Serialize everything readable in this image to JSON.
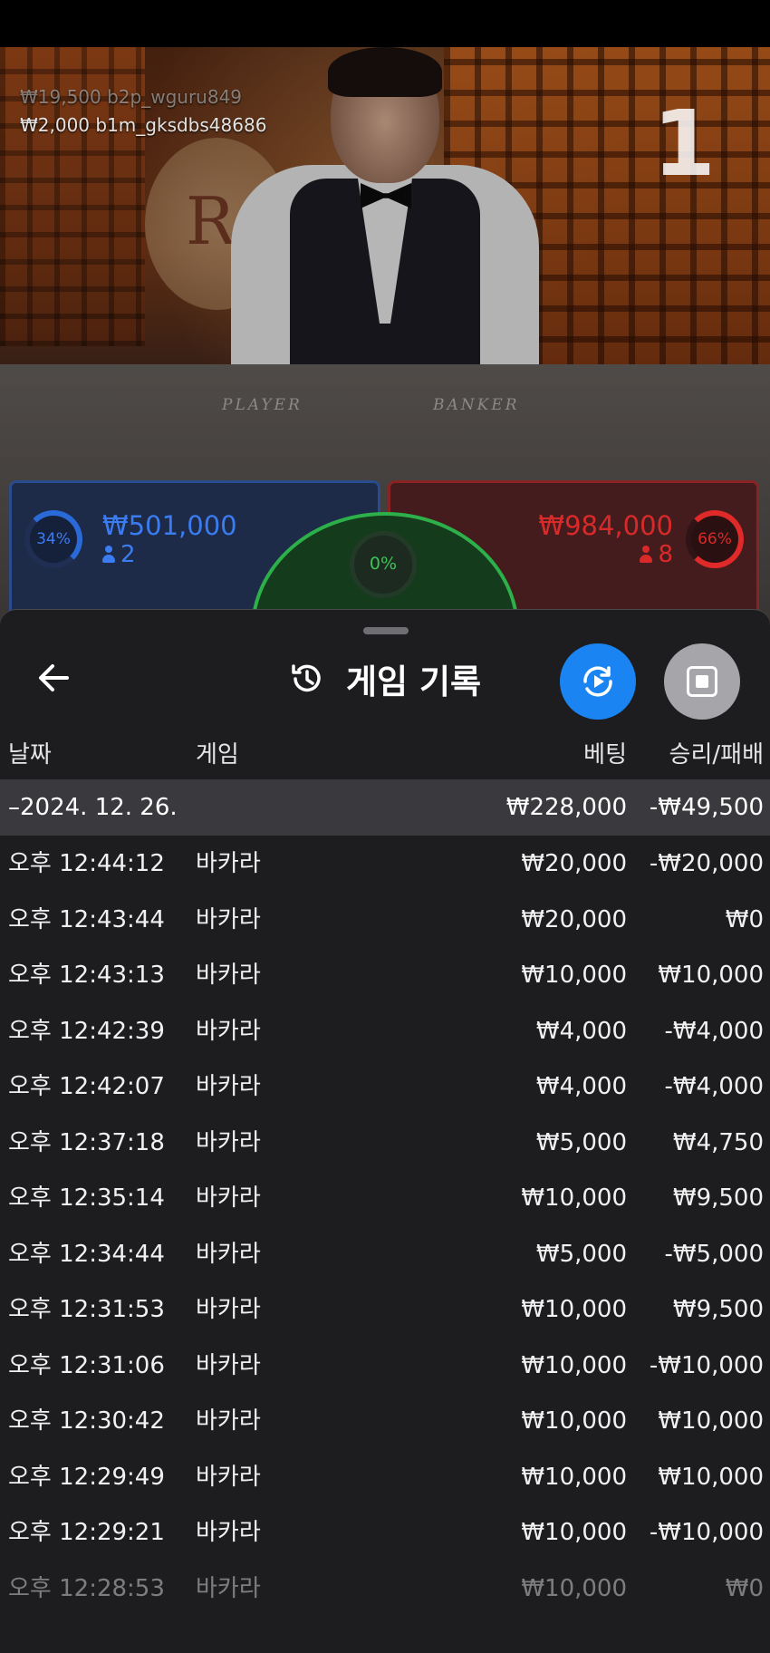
{
  "video": {
    "bet_feed": [
      "₩19,500 b2p_wguru849",
      "₩2,000  b1m_gksdbs48686"
    ],
    "round_number": "1",
    "table_labels": {
      "player": "PLAYER",
      "banker": "BANKER"
    },
    "player": {
      "percent": "34%",
      "amount": "₩501,000",
      "count": "2"
    },
    "banker": {
      "percent": "66%",
      "amount": "₩984,000",
      "count": "8"
    },
    "tie": {
      "percent": "0%"
    },
    "colors": {
      "player": "#3b7cf0",
      "banker": "#d92a2a",
      "tie": "#3cc457"
    }
  },
  "history": {
    "title": "게임 기록",
    "icons": {
      "back": "arrow-left-icon",
      "title": "history-icon",
      "replay": "replay-icon",
      "stop": "stop-icon"
    },
    "columns": {
      "date": "날짜",
      "game": "게임",
      "bet": "베팅",
      "result": "승리/패배"
    },
    "day": {
      "date": "–2024. 12. 26.",
      "bet": "₩228,000",
      "result": "-₩49,500"
    },
    "rows": [
      {
        "time": "오후 12:44:12",
        "game": "바카라",
        "bet": "₩20,000",
        "result": "-₩20,000"
      },
      {
        "time": "오후 12:43:44",
        "game": "바카라",
        "bet": "₩20,000",
        "result": "₩0"
      },
      {
        "time": "오후 12:43:13",
        "game": "바카라",
        "bet": "₩10,000",
        "result": "₩10,000"
      },
      {
        "time": "오후 12:42:39",
        "game": "바카라",
        "bet": "₩4,000",
        "result": "-₩4,000"
      },
      {
        "time": "오후 12:42:07",
        "game": "바카라",
        "bet": "₩4,000",
        "result": "-₩4,000"
      },
      {
        "time": "오후 12:37:18",
        "game": "바카라",
        "bet": "₩5,000",
        "result": "₩4,750"
      },
      {
        "time": "오후 12:35:14",
        "game": "바카라",
        "bet": "₩10,000",
        "result": "₩9,500"
      },
      {
        "time": "오후 12:34:44",
        "game": "바카라",
        "bet": "₩5,000",
        "result": "-₩5,000"
      },
      {
        "time": "오후 12:31:53",
        "game": "바카라",
        "bet": "₩10,000",
        "result": "₩9,500"
      },
      {
        "time": "오후 12:31:06",
        "game": "바카라",
        "bet": "₩10,000",
        "result": "-₩10,000"
      },
      {
        "time": "오후 12:30:42",
        "game": "바카라",
        "bet": "₩10,000",
        "result": "₩10,000"
      },
      {
        "time": "오후 12:29:49",
        "game": "바카라",
        "bet": "₩10,000",
        "result": "₩10,000"
      },
      {
        "time": "오후 12:29:21",
        "game": "바카라",
        "bet": "₩10,000",
        "result": "-₩10,000"
      },
      {
        "time": "오후 12:28:53",
        "game": "바카라",
        "bet": "₩10,000",
        "result": "₩0"
      }
    ]
  }
}
